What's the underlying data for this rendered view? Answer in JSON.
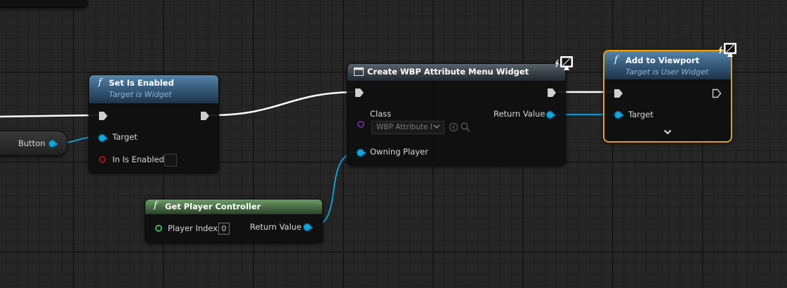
{
  "nodes": {
    "set_enabled": {
      "title": "Set Is Enabled",
      "subtitle": "Target is Widget",
      "target_label": "Target",
      "enabled_label": "In Is Enabled"
    },
    "button_var": {
      "label": "Button"
    },
    "create_widget": {
      "title": "Create WBP Attribute Menu Widget",
      "class_label": "Class",
      "class_value": "WBP Attribute I",
      "return_label": "Return Value",
      "owning_label": "Owning Player"
    },
    "add_viewport": {
      "title": "Add to Viewport",
      "subtitle": "Target is User Widget",
      "target_label": "Target"
    },
    "get_player_controller": {
      "title": "Get Player Controller",
      "index_label": "Player Index",
      "index_value": "0",
      "return_label": "Return Value"
    }
  },
  "glyphs": {
    "function": "f"
  },
  "icons": [
    "function-icon",
    "exec-pin-icon",
    "data-pin-icon",
    "monitor-icon",
    "dropdown-arrow-icon",
    "browse-icon",
    "search-icon",
    "expand-chevron-icon"
  ],
  "colors": {
    "exec_wire": "#ffffff",
    "object_wire": "#10a7e0",
    "bool_pin": "#a51414",
    "selection": "#f1a00a",
    "int_pin": "#3ab36b",
    "class_pin": "#6a2b95"
  }
}
